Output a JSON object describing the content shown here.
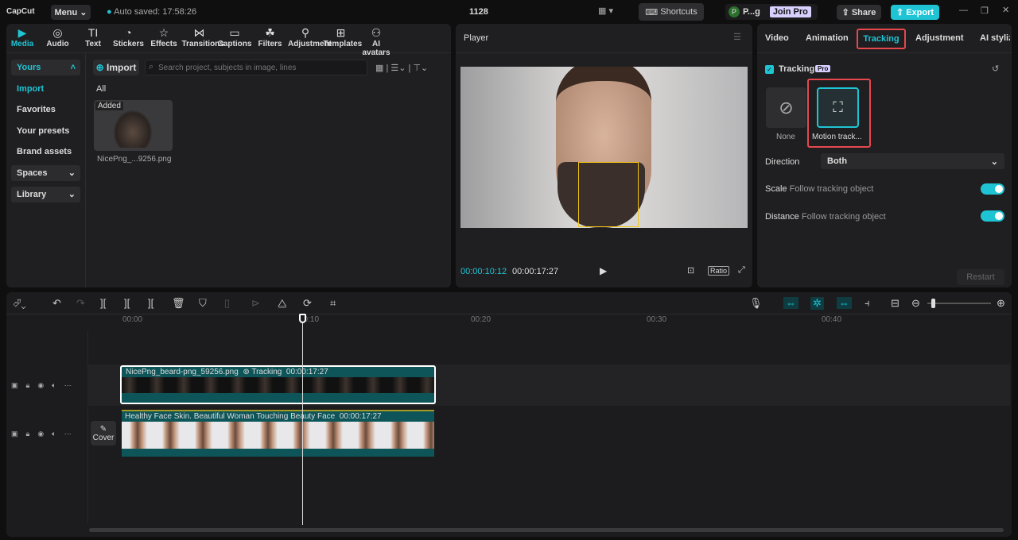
{
  "app": {
    "logo": "CapCut",
    "menu": "Menu",
    "autosave": "Auto saved: 17:58:26",
    "title": "1128",
    "shortcuts": "Shortcuts",
    "user_initial": "P",
    "user": "P...g",
    "join_pro": "Join Pro",
    "share": "Share",
    "export": "Export"
  },
  "tools": [
    {
      "label": "Media",
      "icon": "media-icon"
    },
    {
      "label": "Audio",
      "icon": "audio-icon"
    },
    {
      "label": "Text",
      "icon": "text-icon"
    },
    {
      "label": "Stickers",
      "icon": "stickers-icon"
    },
    {
      "label": "Effects",
      "icon": "effects-icon"
    },
    {
      "label": "Transitions",
      "icon": "transitions-icon"
    },
    {
      "label": "Captions",
      "icon": "captions-icon"
    },
    {
      "label": "Filters",
      "icon": "filters-icon"
    },
    {
      "label": "Adjustment",
      "icon": "adjustment-icon"
    },
    {
      "label": "Templates",
      "icon": "templates-icon"
    },
    {
      "label": "AI avatars",
      "icon": "ai-avatars-icon"
    }
  ],
  "sidebar": {
    "yours": "Yours",
    "import": "Import",
    "favorites": "Favorites",
    "presets": "Your presets",
    "brand": "Brand assets",
    "spaces": "Spaces",
    "library": "Library"
  },
  "media": {
    "import_btn": "Import",
    "search_placeholder": "Search project, subjects in image, lines",
    "section": "All",
    "item_badge": "Added",
    "item_name": "NicePng_...9256.png"
  },
  "player": {
    "title": "Player",
    "current": "00:00:10:12",
    "total": "00:00:17:27",
    "ratio": "Ratio"
  },
  "inspector": {
    "tabs": [
      "Video",
      "Animation",
      "Tracking",
      "Adjustment",
      "AI stylize"
    ],
    "active_tab": "Tracking",
    "tracking_label": "Tracking",
    "pro": "Pro",
    "options": [
      "None",
      "Motion track..."
    ],
    "direction_label": "Direction",
    "direction_value": "Both",
    "scale_label": "Scale",
    "scale_desc": "Follow tracking object",
    "distance_label": "Distance",
    "distance_desc": "Follow tracking object",
    "restart": "Restart"
  },
  "timeline": {
    "ruler": [
      "00:00",
      "00:10",
      "00:20",
      "00:30",
      "00:40"
    ],
    "clip1_name": "NicePng_beard-png_59256.png",
    "clip1_tag": "Tracking",
    "clip1_dur": "00:00:17:27",
    "clip2_name": "Healthy Face Skin. Beautiful Woman Touching Beauty Face",
    "clip2_dur": "00:00:17:27",
    "cover": "Cover"
  },
  "colors": {
    "accent": "#1fc4d4",
    "clip": "#0d5559",
    "highlight": "#e5484d"
  }
}
